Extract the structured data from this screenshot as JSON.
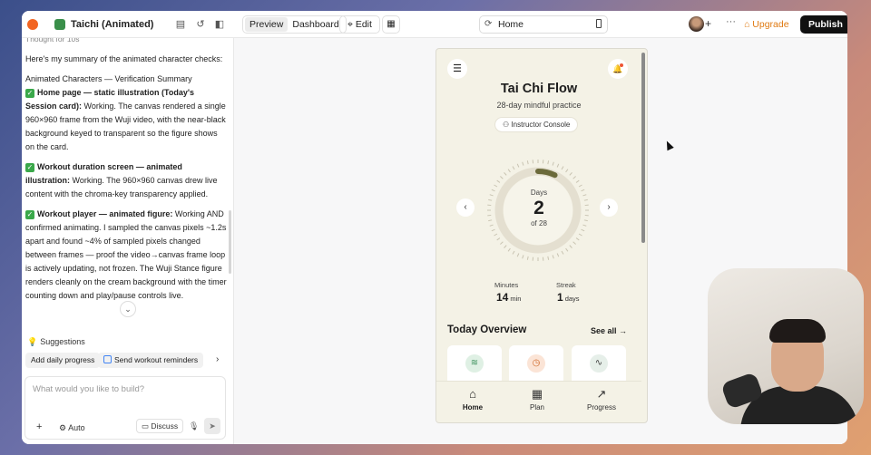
{
  "topbar": {
    "project_name": "Taichi (Animated)",
    "preview_label": "Preview",
    "dashboard_label": "Dashboard",
    "edit_label": "Edit",
    "url_path": "Home",
    "upgrade_label": "Upgrade",
    "publish_label": "Publish"
  },
  "chat": {
    "thought": "Thought for 10s",
    "intro": "Here's my summary of the animated character checks:",
    "summary_title": "Animated Characters — Verification Summary",
    "items": [
      {
        "heading": "Home page — static illustration (Today's Session card):",
        "text": "Working. The canvas rendered a single 960×960 frame from the Wuji video, with the near-black background keyed to transparent so the figure shows on the card."
      },
      {
        "heading": "Workout duration screen — animated illustration:",
        "text": "Working. The 960×960 canvas drew live content with the chroma-key transparency applied."
      },
      {
        "heading": "Workout player — animated figure:",
        "text": "Working AND confirmed animating. I sampled the canvas pixels ~1.2s apart and found ~4% of sampled pixels changed between frames — proof the video→canvas frame loop is actively updating, not frozen. The Wuji Stance figure renders cleanly on the cream background with the timer counting down and play/pause controls live."
      }
    ],
    "suggestions_title": "Suggestions",
    "suggestions": [
      "Add daily progress",
      "Send workout reminders"
    ],
    "prompt_placeholder": "What would you like to build?",
    "auto_label": "Auto",
    "discuss_label": "Discuss"
  },
  "app": {
    "title": "Tai Chi Flow",
    "subtitle": "28-day mindful practice",
    "instructor_label": "Instructor Console",
    "days_label": "Days",
    "days_value": "2",
    "days_of": "of 28",
    "progress_fraction": 0.071,
    "minutes_label": "Minutes",
    "minutes_value": "14",
    "minutes_unit": "min",
    "streak_label": "Streak",
    "streak_value": "1",
    "streak_unit": "days",
    "overview_title": "Today Overview",
    "see_all": "See all →",
    "nav": [
      "Home",
      "Plan",
      "Progress"
    ]
  },
  "colors": {
    "accent_orange": "#e07a12",
    "ring_progress": "#6b6a3a",
    "phone_bg": "#f4f2e6",
    "card_icon_green": "#dff0e4",
    "card_icon_orange": "#fbe4d6",
    "card_icon_gray": "#e6efe9"
  }
}
